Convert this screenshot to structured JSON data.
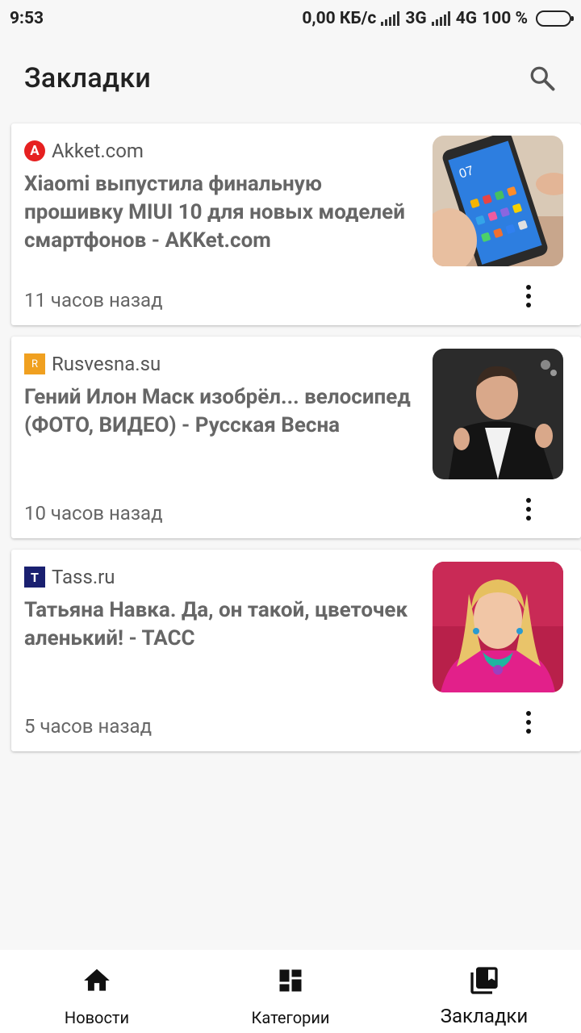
{
  "status_bar": {
    "time": "9:53",
    "net_speed": "0,00 КБ/с",
    "net1": "3G",
    "net2": "4G",
    "battery": "100 %"
  },
  "app_bar": {
    "title": "Закладки",
    "search_icon": "search-icon"
  },
  "articles": [
    {
      "source": "Akket.com",
      "source_icon_letter": "A",
      "headline": "Xiaomi выпустила финальную прошивку MIUI 10 для новых моделей смартфонов - AKKet.com",
      "time": "11 часов назад"
    },
    {
      "source": "Rusvesna.su",
      "source_icon_letter": "R",
      "headline": "Гений Илон Маск изобрёл... велосипед (ФОТО, ВИДЕО) - Русская Весна",
      "time": "10 часов назад"
    },
    {
      "source": "Tass.ru",
      "source_icon_letter": "Т",
      "headline": "Татьяна Навка. Да, он такой, цветочек аленький! - ТАСС",
      "time": "5 часов назад"
    }
  ],
  "bottom_nav": {
    "news": "Новости",
    "categories": "Категории",
    "bookmarks": "Закладки"
  },
  "colors": {
    "background": "#f7f7f7",
    "card": "#ffffff",
    "akket_red": "#e62020",
    "rusvesna_orange": "#f0a020",
    "tass_navy": "#1a2070"
  }
}
